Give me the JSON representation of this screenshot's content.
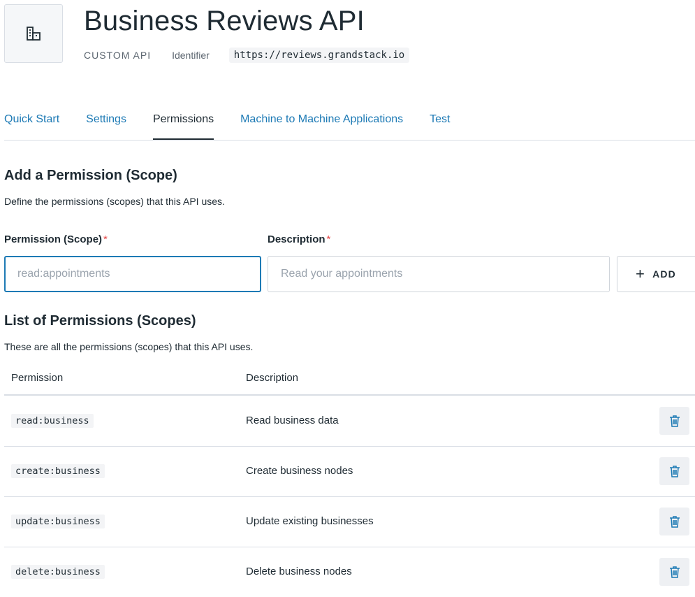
{
  "header": {
    "icon": "api-building-icon",
    "title": "Business Reviews API",
    "api_type": "CUSTOM API",
    "identifier_label": "Identifier",
    "identifier_value": "https://reviews.grandstack.io"
  },
  "tabs": [
    {
      "label": "Quick Start",
      "active": false
    },
    {
      "label": "Settings",
      "active": false
    },
    {
      "label": "Permissions",
      "active": true
    },
    {
      "label": "Machine to Machine Applications",
      "active": false
    },
    {
      "label": "Test",
      "active": false
    }
  ],
  "add_section": {
    "title": "Add a Permission (Scope)",
    "description": "Define the permissions (scopes) that this API uses.",
    "permission_label": "Permission (Scope)",
    "permission_placeholder": "read:appointments",
    "permission_value": "",
    "description_label": "Description",
    "description_placeholder": "Read your appointments",
    "description_value": "",
    "required_marker": "*",
    "add_button_icon": "plus-icon",
    "add_button_label": "ADD"
  },
  "list_section": {
    "title": "List of Permissions (Scopes)",
    "description": "These are all the permissions (scopes) that this API uses.",
    "columns": {
      "permission": "Permission",
      "description": "Description"
    },
    "rows": [
      {
        "permission": "read:business",
        "description": "Read business data"
      },
      {
        "permission": "create:business",
        "description": "Create business nodes"
      },
      {
        "permission": "update:business",
        "description": "Update existing businesses"
      },
      {
        "permission": "delete:business",
        "description": "Delete business nodes"
      }
    ],
    "row_action_icon": "trash-icon"
  },
  "colors": {
    "link": "#1d7ab5",
    "text": "#1f2b33",
    "required": "#e54b4b",
    "border": "#d9dee5",
    "focus": "#1d7ab5"
  }
}
